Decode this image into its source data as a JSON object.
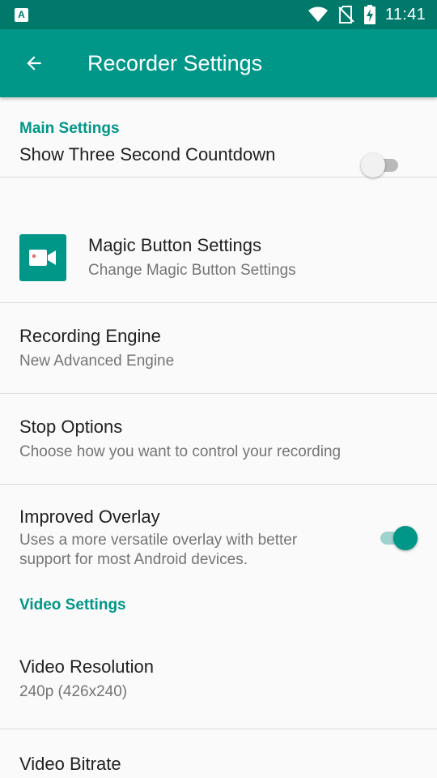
{
  "status_bar": {
    "notification_icon_letter": "A",
    "time": "11:41",
    "icons": [
      "wifi-icon",
      "no-sim-icon",
      "battery-charging-icon"
    ]
  },
  "app_bar": {
    "title": "Recorder Settings",
    "back_icon": "arrow-back-icon"
  },
  "colors": {
    "status_bar": "#00796b",
    "app_bar": "#009688",
    "accent": "#009688",
    "background": "#fafafa",
    "divider": "#dcdcdc",
    "title_text": "#212121",
    "summary_text": "#757575"
  },
  "main_settings": {
    "header": "Main Settings",
    "countdown": {
      "title": "Show Three Second Countdown",
      "enabled": false
    },
    "magic_button": {
      "title": "Magic Button Settings",
      "summary": "Change Magic Button Settings",
      "icon": "video-camera-icon"
    },
    "recording_engine": {
      "title": "Recording Engine",
      "summary": "New Advanced Engine"
    },
    "stop_options": {
      "title": "Stop Options",
      "summary": "Choose how you want to control your recording"
    },
    "improved_overlay": {
      "title": "Improved Overlay",
      "summary_line1": "Uses a more versatile overlay with better",
      "summary_line2": "support for most Android devices.",
      "enabled": true
    }
  },
  "video_settings": {
    "header": "Video Settings",
    "resolution": {
      "title": "Video Resolution",
      "summary": "240p (426x240)"
    },
    "bitrate": {
      "title": "Video Bitrate"
    }
  }
}
